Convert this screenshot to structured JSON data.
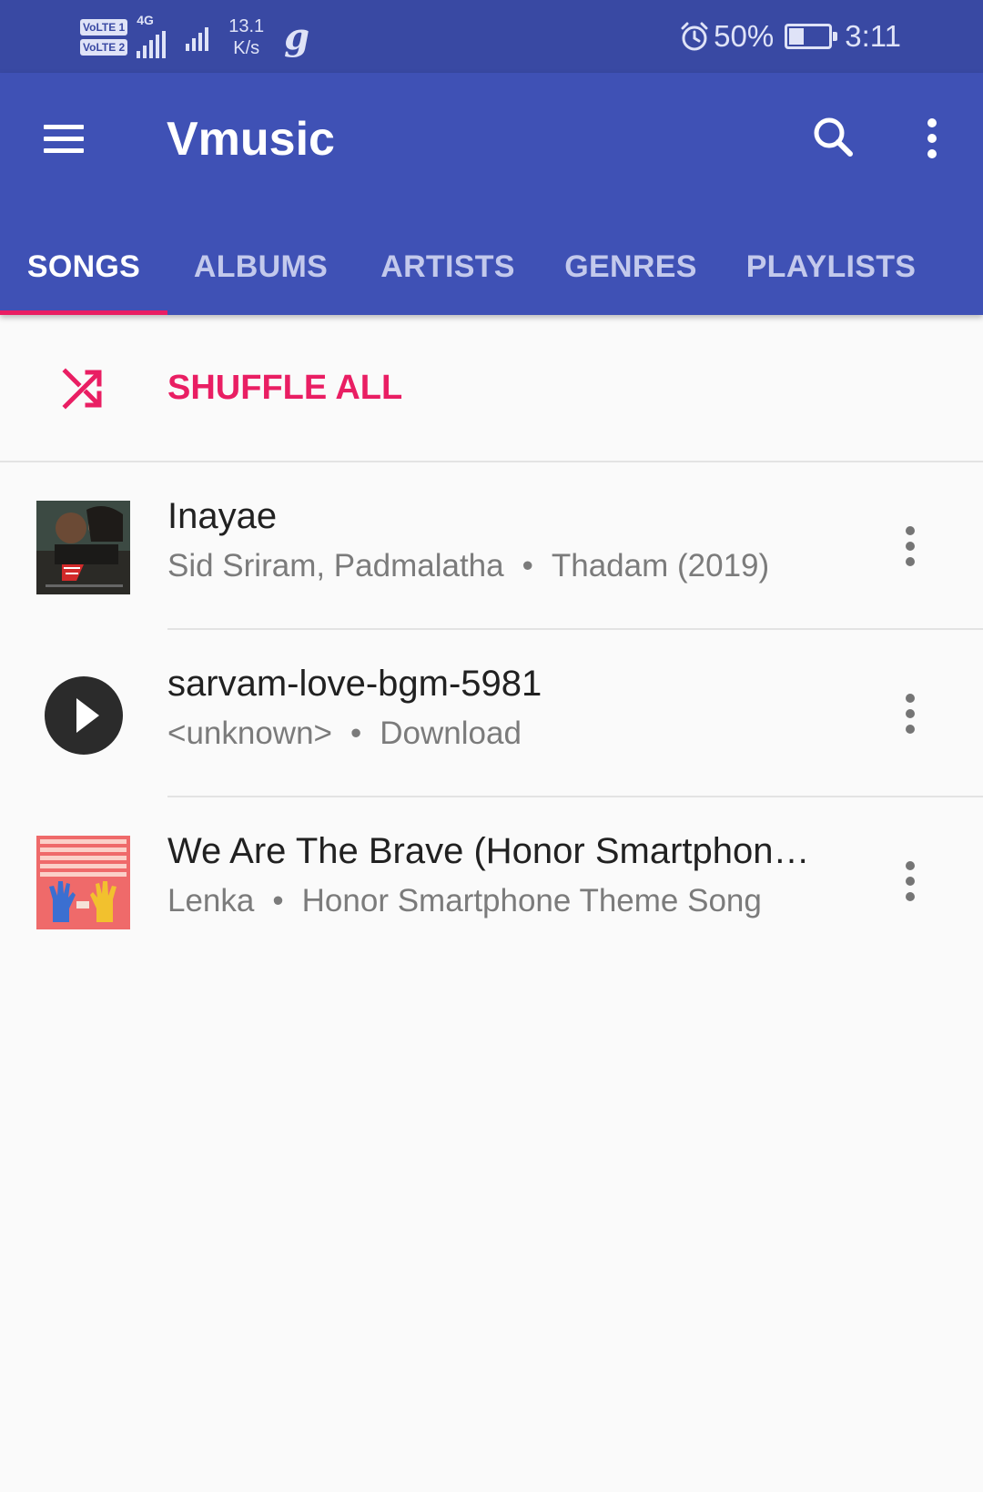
{
  "status_bar": {
    "sim1_label": "VoLTE 1",
    "sim2_label": "VoLTE 2",
    "network_type": "4G",
    "speed_value": "13.1",
    "speed_unit": "K/s",
    "app_icon": "g",
    "battery_percent": "50%",
    "battery_level": 0.4,
    "time": "3:11"
  },
  "app_bar": {
    "title": "Vmusic",
    "menu_icon": "hamburger-menu-icon",
    "search_icon": "search-icon",
    "overflow_icon": "more-vert-icon"
  },
  "tabs": [
    {
      "label": "SONGS",
      "active": true
    },
    {
      "label": "ALBUMS",
      "active": false
    },
    {
      "label": "ARTISTS",
      "active": false
    },
    {
      "label": "GENRES",
      "active": false
    },
    {
      "label": "PLAYLISTS",
      "active": false
    }
  ],
  "shuffle": {
    "label": "SHUFFLE ALL",
    "icon": "shuffle-icon"
  },
  "songs": [
    {
      "title": "Inayae",
      "artist": "Sid Sriram, Padmalatha",
      "album": "Thadam (2019)",
      "art": "album-art-thadam"
    },
    {
      "title": "sarvam-love-bgm-5981",
      "artist": "<unknown>",
      "album": "Download",
      "art": "play-circle-icon"
    },
    {
      "title": "We Are The Brave (Honor Smartphone Theme Song)",
      "artist": "Lenka",
      "album": "Honor Smartphone Theme Song",
      "art": "album-art-we-are-the-brave"
    }
  ],
  "separator": "•",
  "colors": {
    "status_bar": "#3949a3",
    "primary": "#3f51b5",
    "accent": "#e91e63",
    "background": "#fafafa",
    "title_text": "#212121",
    "secondary_text": "#7b7b7b"
  }
}
